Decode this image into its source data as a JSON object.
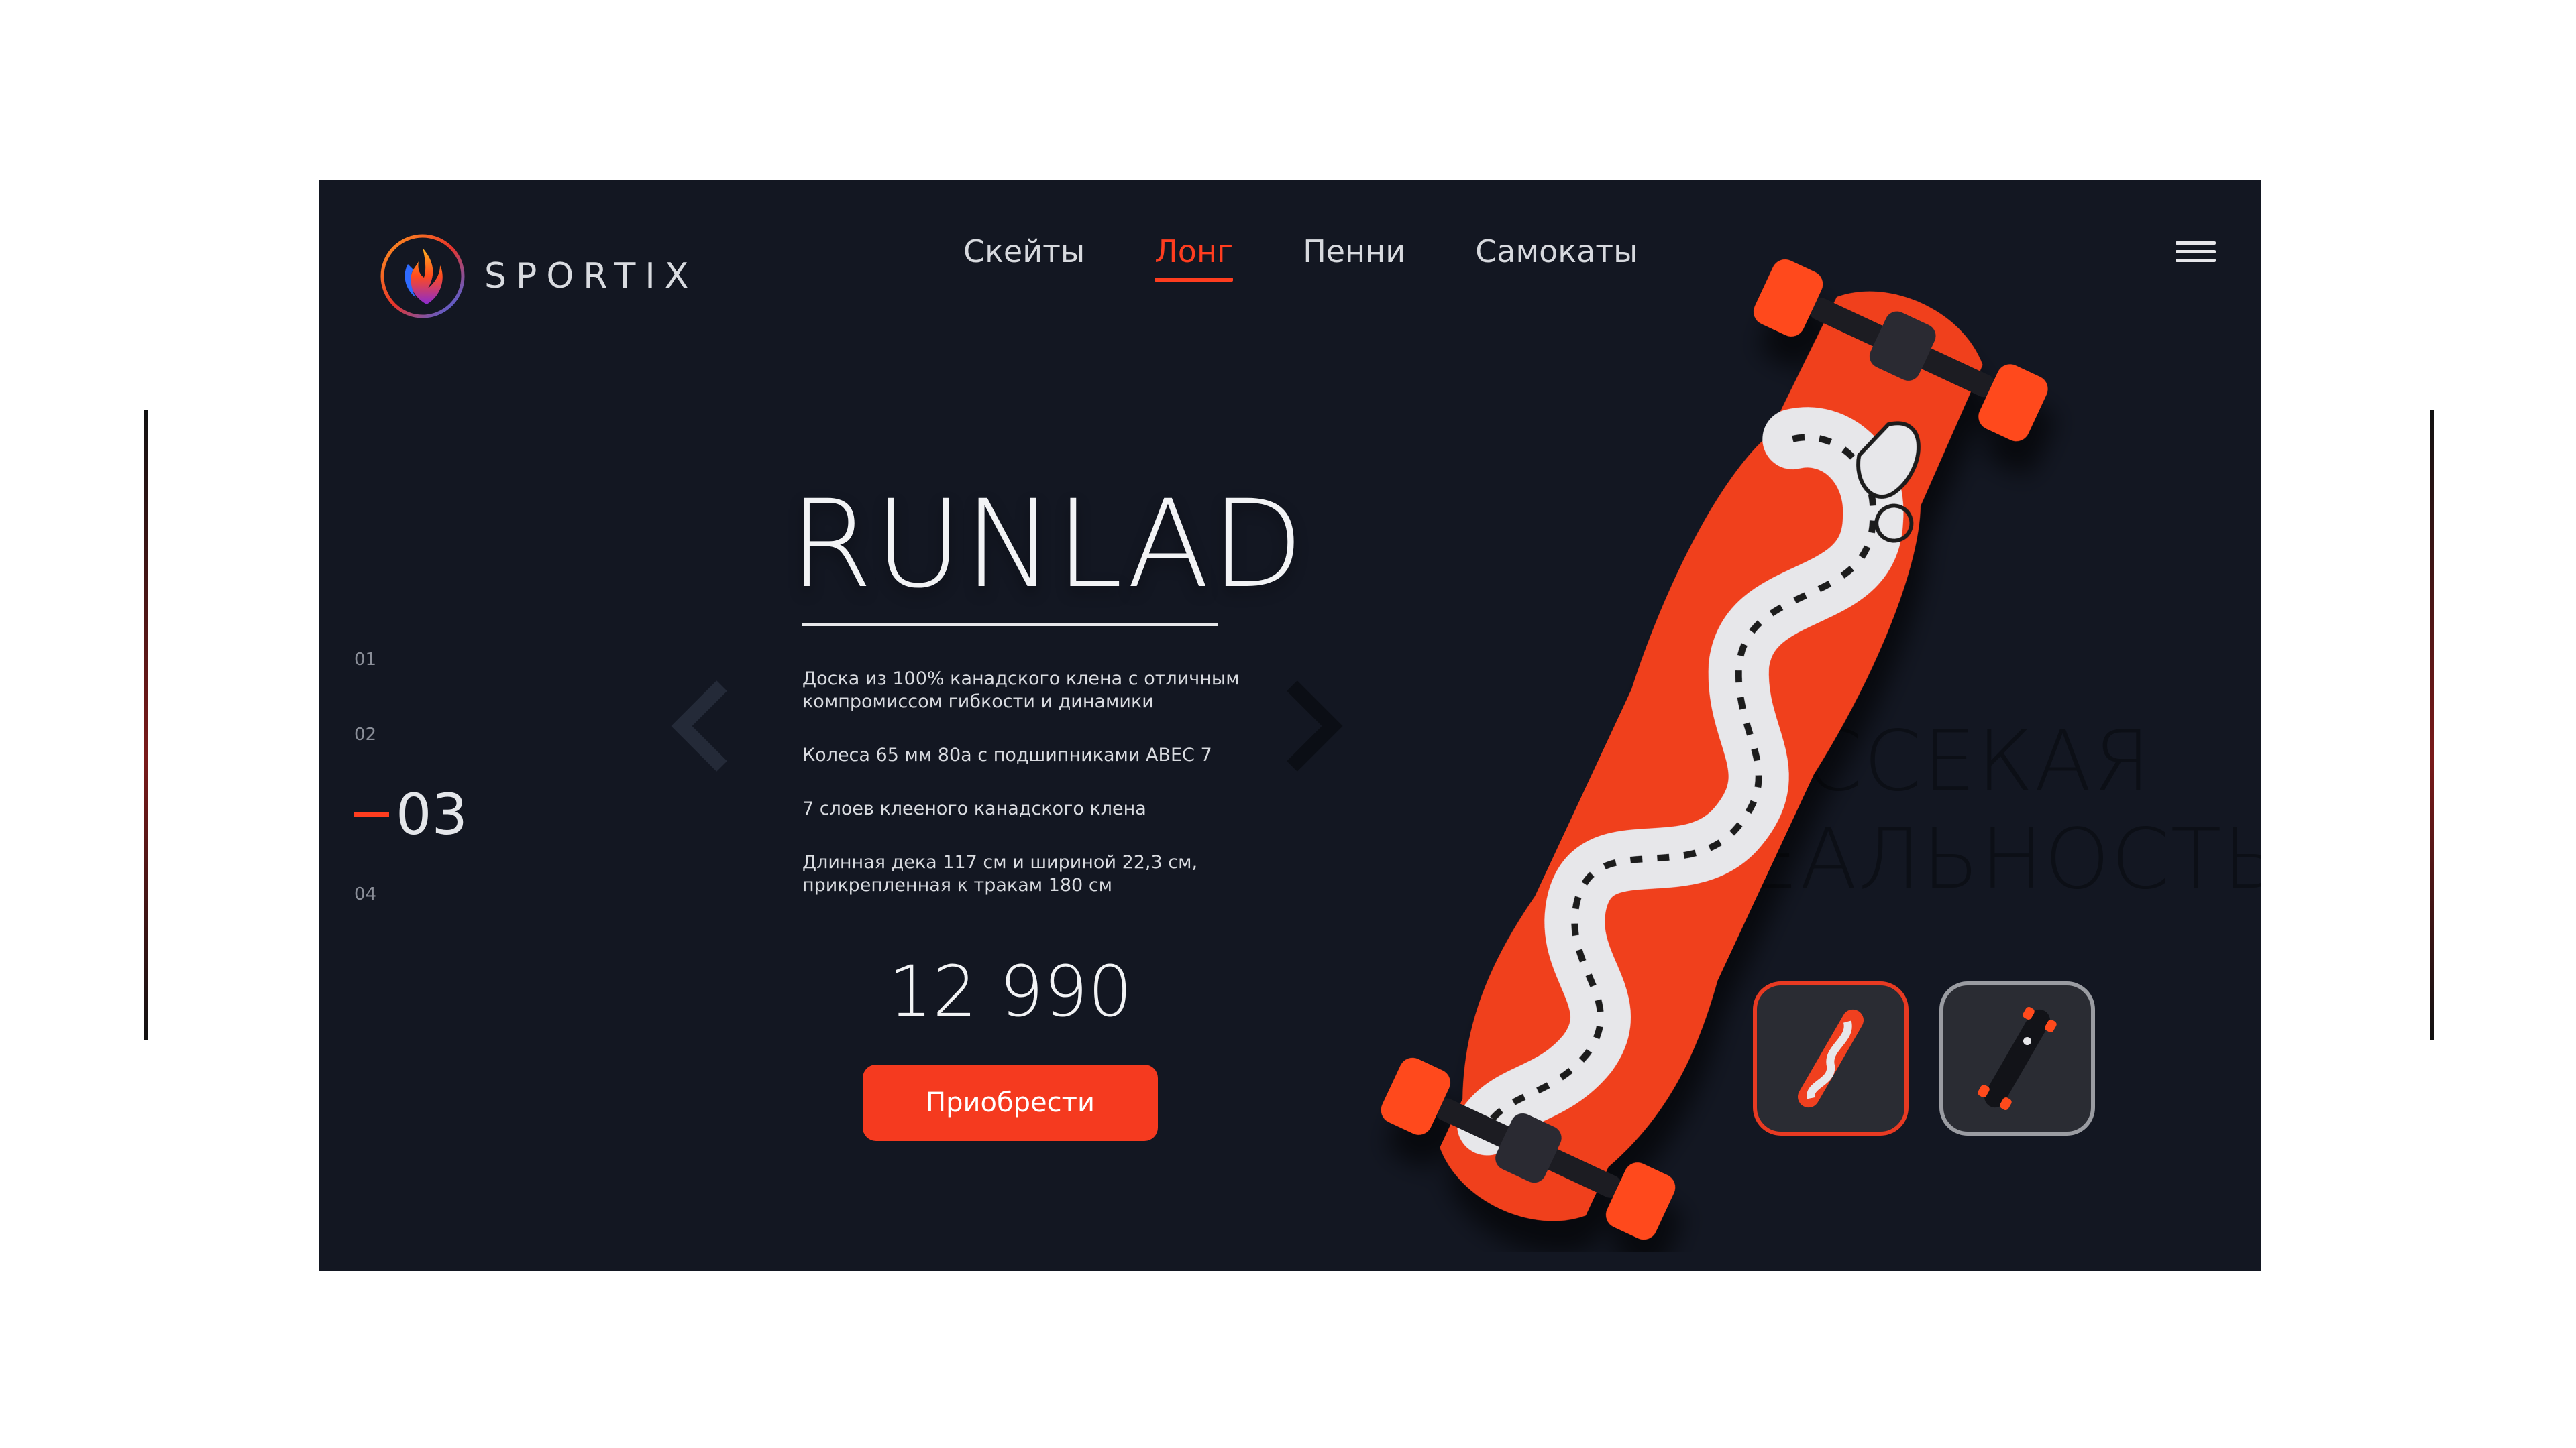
{
  "brand": {
    "name": "SPORTIX"
  },
  "nav": {
    "items": [
      {
        "label": "Скейты"
      },
      {
        "label": "Лонг"
      },
      {
        "label": "Пенни"
      },
      {
        "label": "Самокаты"
      }
    ],
    "active": "Лонг"
  },
  "pager": {
    "items": [
      "01",
      "02",
      "03",
      "04"
    ],
    "active": "03"
  },
  "product": {
    "name": "RUNLAD",
    "features": [
      "Доска из 100% канадского клена с отличным компромиссом гибкости и динамики",
      "Колеса 65 мм 80а с подшипниками ABEC 7",
      "7 слоев клееного канадского клена",
      "Длинная дека 117 см и шириной 22,3 см, прикрепленная к тракам 180 см"
    ],
    "price": "12 990",
    "buy_label": "Приобрести"
  },
  "slogan": {
    "line1": "РАССЕКАЯ",
    "line2": "РЕАЛЬНОСТЬ"
  },
  "colors": {
    "accent": "#f53a1f",
    "background": "#131722",
    "text": "#e6e7ea"
  },
  "icons": {
    "logo": "phoenix-logo-icon",
    "menu": "hamburger-menu-icon",
    "prev": "chevron-left-icon",
    "next": "chevron-right-icon"
  }
}
